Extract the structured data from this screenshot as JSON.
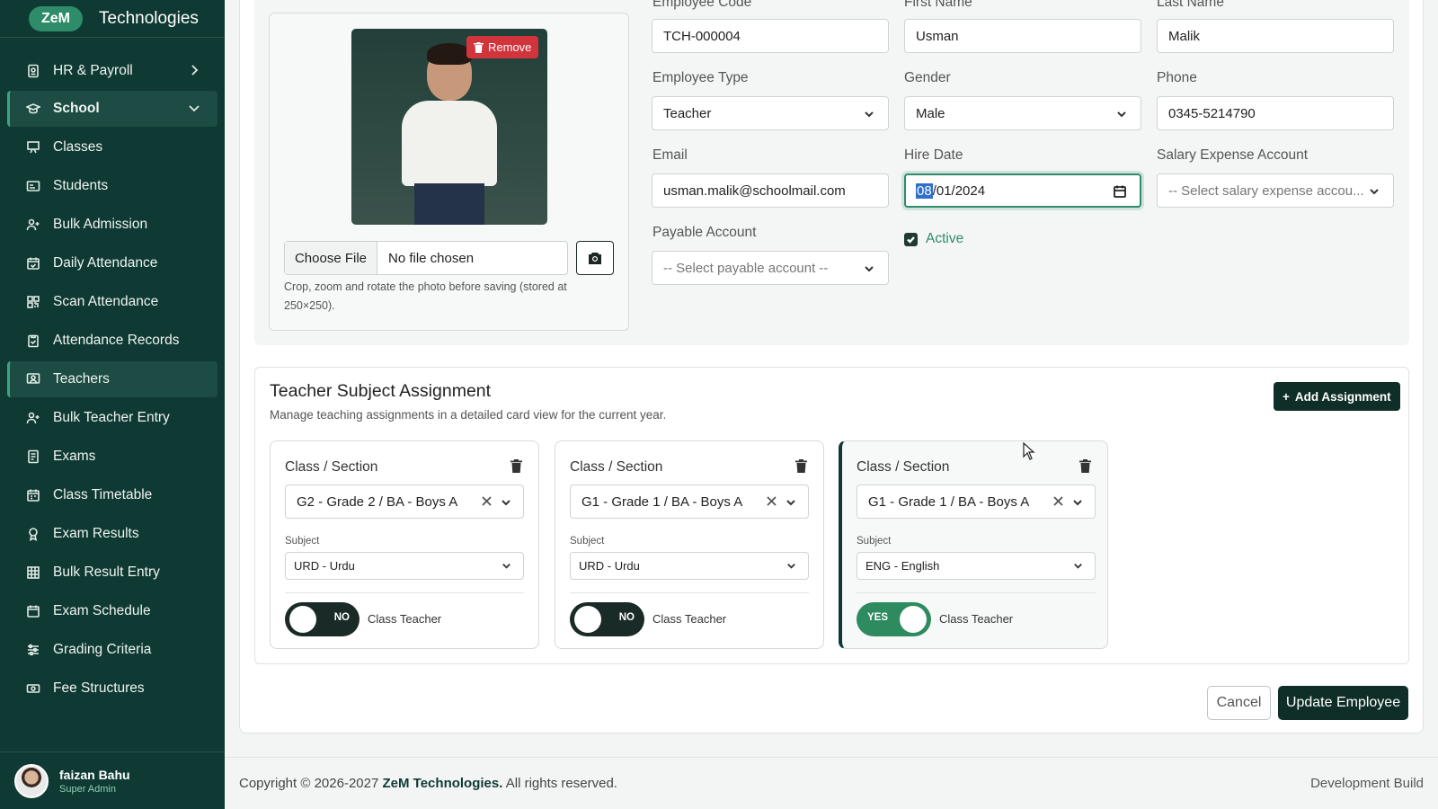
{
  "brand": {
    "logo": "ZeM",
    "name": "Technologies"
  },
  "sidebar": {
    "items": [
      {
        "label": "HR & Payroll",
        "icon": "id-card-icon"
      },
      {
        "label": "School",
        "icon": "graduation-cap-icon"
      },
      {
        "label": "Classes",
        "icon": "chalkboard-icon"
      },
      {
        "label": "Students",
        "icon": "student-id-icon"
      },
      {
        "label": "Bulk Admission",
        "icon": "user-plus-icon"
      },
      {
        "label": "Daily Attendance",
        "icon": "calendar-check-icon"
      },
      {
        "label": "Scan Attendance",
        "icon": "qr-code-icon"
      },
      {
        "label": "Attendance Records",
        "icon": "clipboard-icon"
      },
      {
        "label": "Teachers",
        "icon": "teacher-icon"
      },
      {
        "label": "Bulk Teacher Entry",
        "icon": "user-plus-icon"
      },
      {
        "label": "Exams",
        "icon": "exam-icon"
      },
      {
        "label": "Class Timetable",
        "icon": "calendar-icon"
      },
      {
        "label": "Exam Results",
        "icon": "award-icon"
      },
      {
        "label": "Bulk Result Entry",
        "icon": "grid-icon"
      },
      {
        "label": "Exam Schedule",
        "icon": "calendar-icon"
      },
      {
        "label": "Grading Criteria",
        "icon": "sliders-icon"
      },
      {
        "label": "Fee Structures",
        "icon": "money-icon"
      }
    ]
  },
  "user": {
    "name": "faizan Bahu",
    "role": "Super Admin"
  },
  "photo": {
    "remove_label": "Remove",
    "choose_file_label": "Choose File",
    "file_status": "No file chosen",
    "hint": "Crop, zoom and rotate the photo before saving (stored at 250×250)."
  },
  "form": {
    "employee_code": {
      "label": "Employee Code",
      "value": "TCH-000004"
    },
    "first_name": {
      "label": "First Name",
      "value": "Usman"
    },
    "last_name": {
      "label": "Last Name",
      "value": "Malik"
    },
    "employee_type": {
      "label": "Employee Type",
      "value": "Teacher"
    },
    "gender": {
      "label": "Gender",
      "value": "Male"
    },
    "phone": {
      "label": "Phone",
      "value": "0345-5214790"
    },
    "email": {
      "label": "Email",
      "value": "usman.malik@schoolmail.com"
    },
    "hire_date": {
      "label": "Hire Date",
      "value_month": "08",
      "value_rest": "/01/2024"
    },
    "salary_account": {
      "label": "Salary Expense Account",
      "placeholder": "-- Select salary expense accou..."
    },
    "payable_account": {
      "label": "Payable Account",
      "placeholder": "-- Select payable account --"
    },
    "active": {
      "label": "Active",
      "checked": true
    }
  },
  "assignment": {
    "title": "Teacher Subject Assignment",
    "subtitle": "Manage teaching assignments in a detailed card view for the current year.",
    "add_label": "Add Assignment",
    "cards": [
      {
        "class_label": "Class / Section",
        "class_value": "G2 - Grade 2 / BA - Boys A",
        "subject_label": "Subject",
        "subject_value": "URD - Urdu",
        "toggle": "NO",
        "class_teacher_label": "Class Teacher"
      },
      {
        "class_label": "Class / Section",
        "class_value": "G1 - Grade 1 / BA - Boys A",
        "subject_label": "Subject",
        "subject_value": "URD - Urdu",
        "toggle": "NO",
        "class_teacher_label": "Class Teacher"
      },
      {
        "class_label": "Class / Section",
        "class_value": "G1 - Grade 1 / BA - Boys A",
        "subject_label": "Subject",
        "subject_value": "ENG - English",
        "toggle": "YES",
        "class_teacher_label": "Class Teacher"
      }
    ]
  },
  "actions": {
    "cancel": "Cancel",
    "update": "Update Employee"
  },
  "footer": {
    "copyright": "Copyright © 2026-2027",
    "company": "ZeM Technologies.",
    "rights": "All rights reserved.",
    "build": "Development Build"
  },
  "colors": {
    "sidebar": "#0f3a33",
    "accent": "#2f8c6a",
    "danger": "#d2343c",
    "primary_button": "#0f2e28"
  }
}
